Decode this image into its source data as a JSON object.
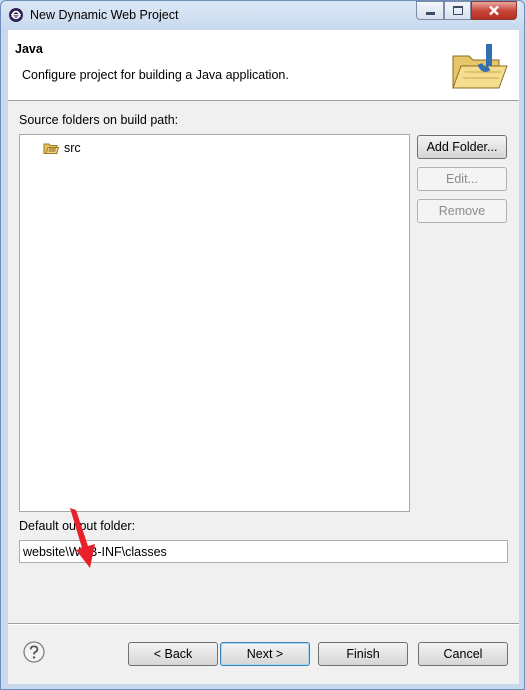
{
  "window": {
    "title": "New Dynamic Web Project"
  },
  "header": {
    "title": "Java",
    "description": "Configure project for building a Java application.",
    "image_icon": "java-folder-icon"
  },
  "source_folders": {
    "label": "Source folders on build path:",
    "items": [
      {
        "name": "src",
        "icon": "source-folder-icon"
      }
    ],
    "buttons": {
      "add": "Add Folder...",
      "edit": "Edit...",
      "remove": "Remove"
    }
  },
  "output": {
    "label": "Default output folder:",
    "value": "website\\WEB-INF\\classes"
  },
  "footer": {
    "back": "< Back",
    "next": "Next >",
    "finish": "Finish",
    "cancel": "Cancel"
  },
  "colors": {
    "accent": "#3c7fb1",
    "annotation_arrow": "#e8202a"
  }
}
